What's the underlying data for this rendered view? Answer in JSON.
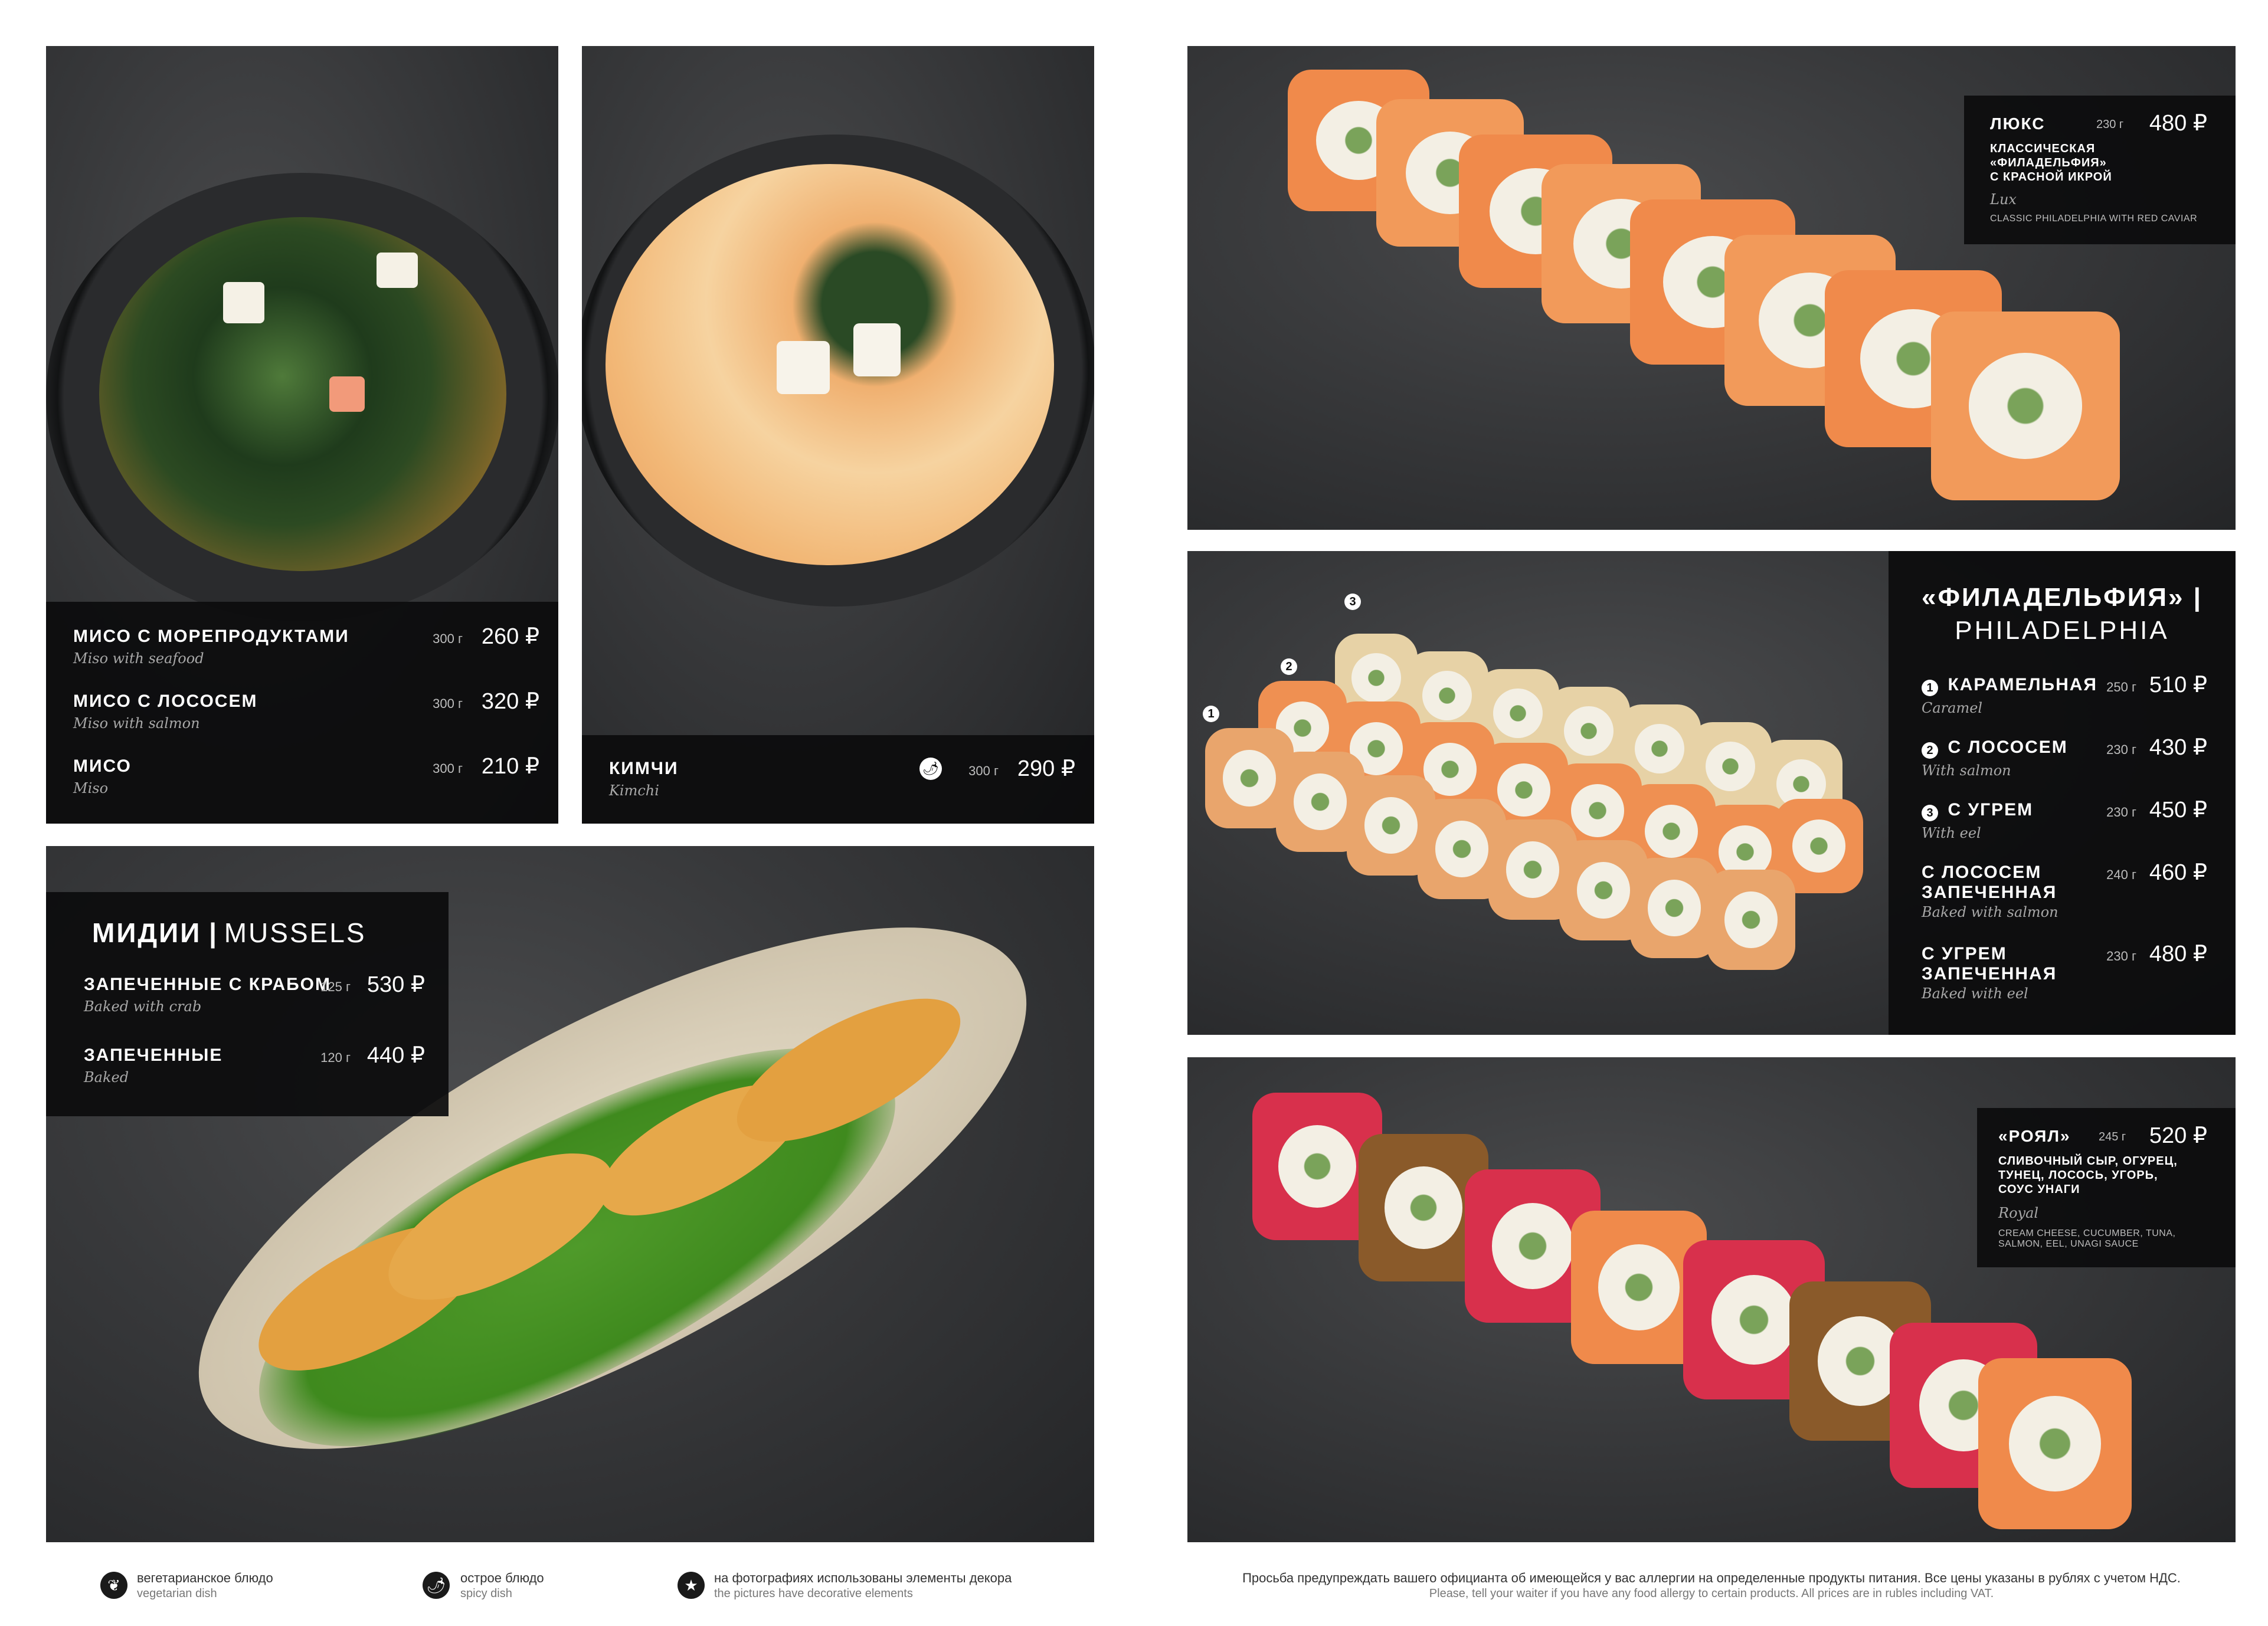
{
  "miso_panel": {
    "items": [
      {
        "name": "Мисо с морепродуктами",
        "script": "Miso with seafood",
        "weight": "300 г",
        "price": "260 ₽"
      },
      {
        "name": "Мисо с лососем",
        "script": "Miso with salmon",
        "weight": "300 г",
        "price": "320 ₽"
      },
      {
        "name": "Мисо",
        "script": "Miso",
        "weight": "300 г",
        "price": "210 ₽"
      }
    ]
  },
  "kimchi_panel": {
    "name": "Кимчи",
    "script": "Kimchi",
    "weight": "300 г",
    "price": "290 ₽",
    "icon": "spicy-icon"
  },
  "mussels_panel": {
    "title_ru": "Мидии",
    "separator": "|",
    "title_en": "MUSSELS",
    "items": [
      {
        "name": "Запеченные с крабом",
        "script": "Baked with crab",
        "weight": "125 г",
        "price": "530 ₽"
      },
      {
        "name": "Запеченные",
        "script": "Baked",
        "weight": "120 г",
        "price": "440 ₽"
      }
    ]
  },
  "lux_panel": {
    "name": "Люкс",
    "weight": "230 г",
    "price": "480 ₽",
    "desc": [
      "классическая",
      "«филадельфия»",
      "с красной икрой"
    ],
    "script": "Lux",
    "en": "CLASSIC PHILADELPHIA WITH RED CAVIAR"
  },
  "philadelphia_panel": {
    "title_ru": "«ФИЛАДЕЛЬФИЯ» |",
    "title_en": "PHILADELPHIA",
    "items": [
      {
        "num": "1",
        "name": "Карамельная",
        "script": "Caramel",
        "weight": "250 г",
        "price": "510 ₽"
      },
      {
        "num": "2",
        "name": "С лососем",
        "script": "With salmon",
        "weight": "230 г",
        "price": "430 ₽"
      },
      {
        "num": "3",
        "name": "С угрем",
        "script": "With eel",
        "weight": "230 г",
        "price": "450 ₽"
      },
      {
        "num": "",
        "name": "С лососем запеченная",
        "script": "Baked with salmon",
        "weight": "240 г",
        "price": "460 ₽"
      },
      {
        "num": "",
        "name": "С угрем запеченная",
        "script": "Baked with eel",
        "weight": "230 г",
        "price": "480 ₽"
      }
    ],
    "photo_markers": [
      "1",
      "2",
      "3"
    ]
  },
  "royal_panel": {
    "name": "«Роял»",
    "weight": "245 г",
    "price": "520 ₽",
    "desc": [
      "сливочный сыр, огурец,",
      "тунец, лосось, угорь,",
      "соус унаги"
    ],
    "script": "Royal",
    "en": [
      "CREAM CHEESE, CUCUMBER, TUNA,",
      "SALMON, EEL, UNAGI SAUCE"
    ]
  },
  "legend": [
    {
      "icon": "vegetarian-icon",
      "ru": "вегетарианское блюдо",
      "en": "vegetarian dish"
    },
    {
      "icon": "spicy-icon",
      "ru": "острое блюдо",
      "en": "spicy dish"
    },
    {
      "icon": "star-icon",
      "ru": "на фотографиях использованы элементы декора",
      "en": "the pictures have decorative elements"
    }
  ],
  "footer_note": {
    "ru": "Просьба предупреждать вашего официанта об имеющейся у вас аллергии на определенные продукты питания. Все цены указаны в рублях с учетом НДС.",
    "en": "Please, tell your waiter if you have any food allergy to certain products. All prices are in rubles including VAT."
  },
  "colors": {
    "panel_dark": "#0c0c0d",
    "background": "#ffffff",
    "salmon": "#f08a4b",
    "tuna": "#d8304c"
  }
}
